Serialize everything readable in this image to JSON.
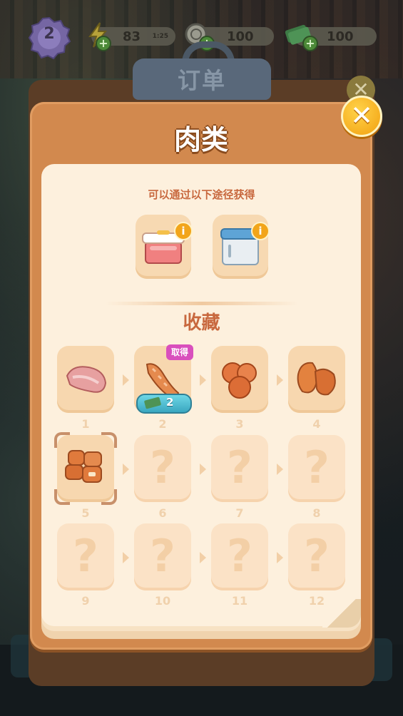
{
  "hud": {
    "level": "2",
    "energy": {
      "value": "83",
      "timer": "1:25"
    },
    "coins": {
      "value": "100"
    },
    "cash": {
      "value": "100"
    }
  },
  "back_panel": {
    "tab_title": "订单"
  },
  "dialog": {
    "title": "肉类",
    "sources_title": "可以通过以下途径获得",
    "sources": [
      {
        "name": "cooler-box",
        "icon": "cooler-box-icon"
      },
      {
        "name": "freezer",
        "icon": "freezer-icon"
      }
    ],
    "collection_title": "收藏",
    "obtain_badge": "取得",
    "price_pill": {
      "currency_icon": "cash-icon",
      "value": "2"
    },
    "items": [
      {
        "level": "1",
        "state": "unlocked",
        "icon": "raw-meat-icon"
      },
      {
        "level": "2",
        "state": "unlocked",
        "icon": "sausage-icon"
      },
      {
        "level": "3",
        "state": "unlocked",
        "icon": "meatballs-icon"
      },
      {
        "level": "4",
        "state": "unlocked",
        "icon": "fried-cutlet-icon"
      },
      {
        "level": "5",
        "state": "selected",
        "icon": "chicken-nuggets-icon"
      },
      {
        "level": "6",
        "state": "locked",
        "placeholder": "?"
      },
      {
        "level": "7",
        "state": "locked",
        "placeholder": "?"
      },
      {
        "level": "8",
        "state": "locked",
        "placeholder": "?"
      },
      {
        "level": "9",
        "state": "locked",
        "placeholder": "?"
      },
      {
        "level": "10",
        "state": "locked",
        "placeholder": "?"
      },
      {
        "level": "11",
        "state": "locked",
        "placeholder": "?"
      },
      {
        "level": "12",
        "state": "locked",
        "placeholder": "?"
      }
    ]
  },
  "colors": {
    "panel": "#d2894e",
    "cream": "#fdf0dd",
    "accent_text": "#c8683e",
    "badge": "#d94fbd",
    "close": "#f2a00f"
  }
}
